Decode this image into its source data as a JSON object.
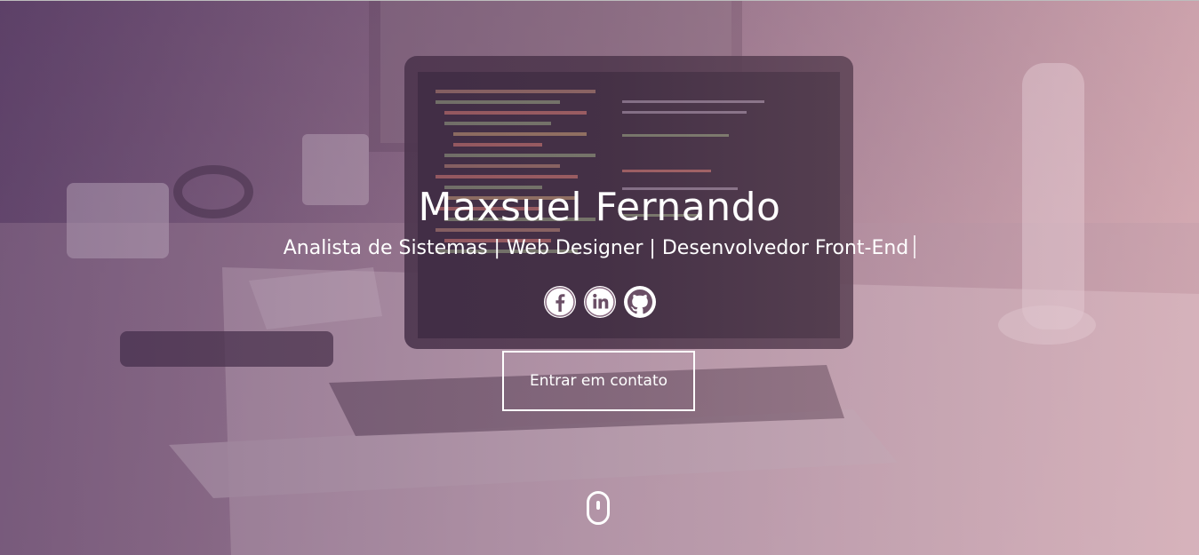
{
  "hero": {
    "name": "Maxsuel Fernando",
    "subtitle": "Analista de Sistemas | Web Designer | Desenvolvedor Front-End",
    "cta_label": "Entrar em contato"
  },
  "socials": [
    {
      "icon": "facebook-icon"
    },
    {
      "icon": "linkedin-icon"
    },
    {
      "icon": "github-icon"
    }
  ],
  "colors": {
    "text": "#ffffff",
    "overlay_left": "#502d5f",
    "overlay_right": "#e6aab4"
  }
}
